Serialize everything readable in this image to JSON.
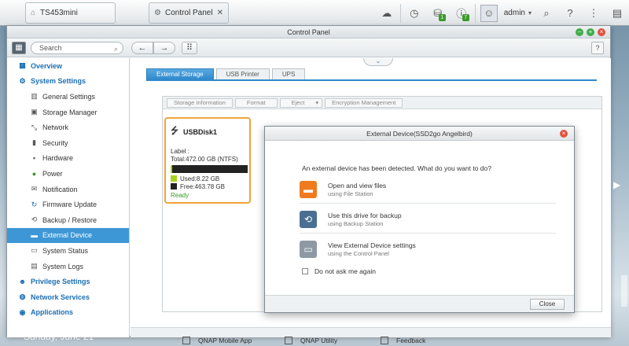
{
  "taskbar": {
    "home_label": "TS453mini",
    "tab_label": "Control Panel",
    "tab_close": "✕",
    "user": "admin",
    "badge_a": "1",
    "badge_b": "7"
  },
  "window": {
    "title": "Control Panel",
    "search_placeholder": "Search",
    "help": "?"
  },
  "sidebar": {
    "overview": "Overview",
    "system_settings": "System Settings",
    "items": [
      {
        "label": "General Settings",
        "icon": "sliders-icon"
      },
      {
        "label": "Storage Manager",
        "icon": "disk-icon"
      },
      {
        "label": "Network",
        "icon": "network-icon"
      },
      {
        "label": "Security",
        "icon": "lock-icon"
      },
      {
        "label": "Hardware",
        "icon": "chip-icon"
      },
      {
        "label": "Power",
        "icon": "bulb-icon"
      },
      {
        "label": "Notification",
        "icon": "notification-icon"
      },
      {
        "label": "Firmware Update",
        "icon": "refresh-icon"
      },
      {
        "label": "Backup / Restore",
        "icon": "backup-icon"
      },
      {
        "label": "External Device",
        "icon": "drive-icon"
      },
      {
        "label": "System Status",
        "icon": "monitor-icon"
      },
      {
        "label": "System Logs",
        "icon": "logs-icon"
      }
    ],
    "privilege_settings": "Privilege Settings",
    "network_services": "Network Services",
    "applications": "Applications"
  },
  "tabs": [
    "External Storage",
    "USB Printer",
    "UPS"
  ],
  "toolbar_buttons": [
    "Storage Information",
    "Format",
    "Eject",
    "Encryption Management"
  ],
  "device": {
    "name": "USBDisk1",
    "label_line": "Label :",
    "total": "Total:472.00 GB (NTFS)",
    "used": "Used:8.22 GB",
    "free": "Free:463.78 GB",
    "status": "Ready",
    "used_fraction": 0.017
  },
  "dialog": {
    "title": "External Device(SSD2go Angelbird)",
    "question": "An external device has been detected. What do you want to do?",
    "options": [
      {
        "main": "Open and view files",
        "sub": "using File Station"
      },
      {
        "main": "Use this drive for backup",
        "sub": "using Backup Station"
      },
      {
        "main": "View External Device settings",
        "sub": "using the Control Panel"
      }
    ],
    "checkbox": "Do not ask me again",
    "close": "Close"
  },
  "desktop": {
    "date": "Sunday, June 21",
    "dock": [
      "QNAP Mobile App",
      "QNAP Utility",
      "Feedback"
    ]
  },
  "colors": {
    "accent": "#2f89cc",
    "selected": "#3d97d6",
    "used": "#a6d31e",
    "card_border": "#f0a33a"
  }
}
